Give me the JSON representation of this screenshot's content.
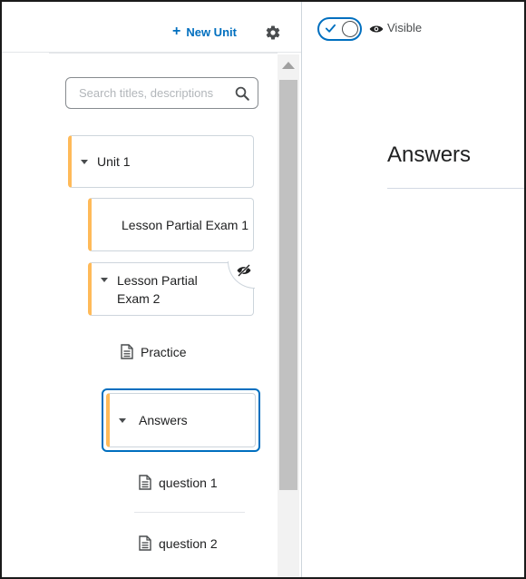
{
  "header": {
    "new_unit_label": "New Unit",
    "new_unit_icon": "plus-icon",
    "settings_icon": "gear-icon"
  },
  "search": {
    "placeholder": "Search titles, descriptions"
  },
  "nav": {
    "unit": {
      "label": "Unit 1",
      "icon": "caret-down-icon"
    },
    "lessons": [
      {
        "label": "Lesson Partial Exam 1"
      },
      {
        "label": "Lesson Partial Exam 2",
        "icon": "caret-down-icon",
        "status_icon": "hidden-eye-icon"
      }
    ],
    "topics": [
      {
        "label": "Practice",
        "icon": "document-icon"
      }
    ],
    "selected_folder": {
      "label": "Answers",
      "icon": "caret-down-icon"
    },
    "children": [
      {
        "label": "question 1",
        "icon": "document-icon"
      },
      {
        "label": "question 2",
        "icon": "document-icon"
      }
    ]
  },
  "content": {
    "visibility_toggle_on": true,
    "visibility_label": "Visible",
    "title": "Answers"
  },
  "colors": {
    "accent": "#006fbf",
    "unit_marker": "#ffba59",
    "border": "#cdd5dc"
  }
}
